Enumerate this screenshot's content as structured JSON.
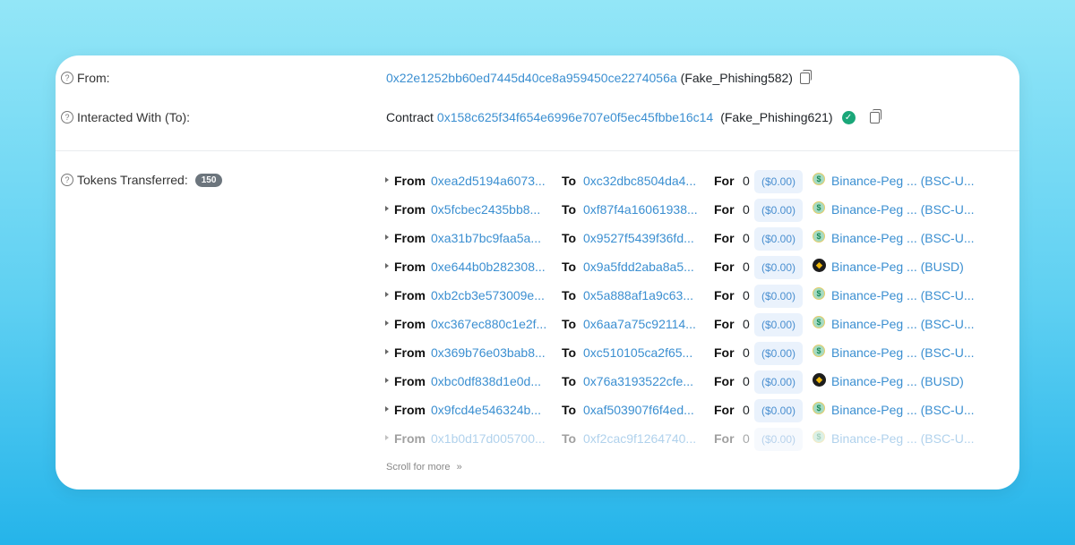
{
  "from": {
    "label": "From:",
    "address": "0x22e1252bb60ed7445d40ce8a959450ce2274056a",
    "tag": "(Fake_Phishing582)"
  },
  "to": {
    "label": "Interacted With (To):",
    "prefix": "Contract",
    "address": "0x158c625f34f654e6996e707e0f5ec45fbbe16c14",
    "tag": "(Fake_Phishing621)"
  },
  "tokens": {
    "label": "Tokens Transferred:",
    "count": "150",
    "kw_from": "From",
    "kw_to": "To",
    "kw_for": "For",
    "rows": [
      {
        "from": "0xea2d5194a6073...",
        "to": "0xc32dbc8504da4...",
        "amount": "0",
        "usd": "($0.00)",
        "icon": "usdt",
        "token": "Binance-Peg ... (BSC-U..."
      },
      {
        "from": "0x5fcbec2435bb8...",
        "to": "0xf87f4a16061938...",
        "amount": "0",
        "usd": "($0.00)",
        "icon": "usdt",
        "token": "Binance-Peg ... (BSC-U..."
      },
      {
        "from": "0xa31b7bc9faa5a...",
        "to": "0x9527f5439f36fd...",
        "amount": "0",
        "usd": "($0.00)",
        "icon": "usdt",
        "token": "Binance-Peg ... (BSC-U..."
      },
      {
        "from": "0xe644b0b282308...",
        "to": "0x9a5fdd2aba8a5...",
        "amount": "0",
        "usd": "($0.00)",
        "icon": "busd",
        "token": "Binance-Peg ... (BUSD)"
      },
      {
        "from": "0xb2cb3e573009e...",
        "to": "0x5a888af1a9c63...",
        "amount": "0",
        "usd": "($0.00)",
        "icon": "usdt",
        "token": "Binance-Peg ... (BSC-U..."
      },
      {
        "from": "0xc367ec880c1e2f...",
        "to": "0x6aa7a75c92114...",
        "amount": "0",
        "usd": "($0.00)",
        "icon": "usdt",
        "token": "Binance-Peg ... (BSC-U..."
      },
      {
        "from": "0x369b76e03bab8...",
        "to": "0xc510105ca2f65...",
        "amount": "0",
        "usd": "($0.00)",
        "icon": "usdt",
        "token": "Binance-Peg ... (BSC-U..."
      },
      {
        "from": "0xbc0df838d1e0d...",
        "to": "0x76a3193522cfe...",
        "amount": "0",
        "usd": "($0.00)",
        "icon": "busd",
        "token": "Binance-Peg ... (BUSD)"
      },
      {
        "from": "0x9fcd4e546324b...",
        "to": "0xaf503907f6f4ed...",
        "amount": "0",
        "usd": "($0.00)",
        "icon": "usdt",
        "token": "Binance-Peg ... (BSC-U..."
      },
      {
        "from": "0x1b0d17d005700...",
        "to": "0xf2cac9f1264740...",
        "amount": "0",
        "usd": "($0.00)",
        "icon": "usdt",
        "token": "Binance-Peg ... (BSC-U..."
      }
    ],
    "scroll_label": "Scroll for more"
  }
}
